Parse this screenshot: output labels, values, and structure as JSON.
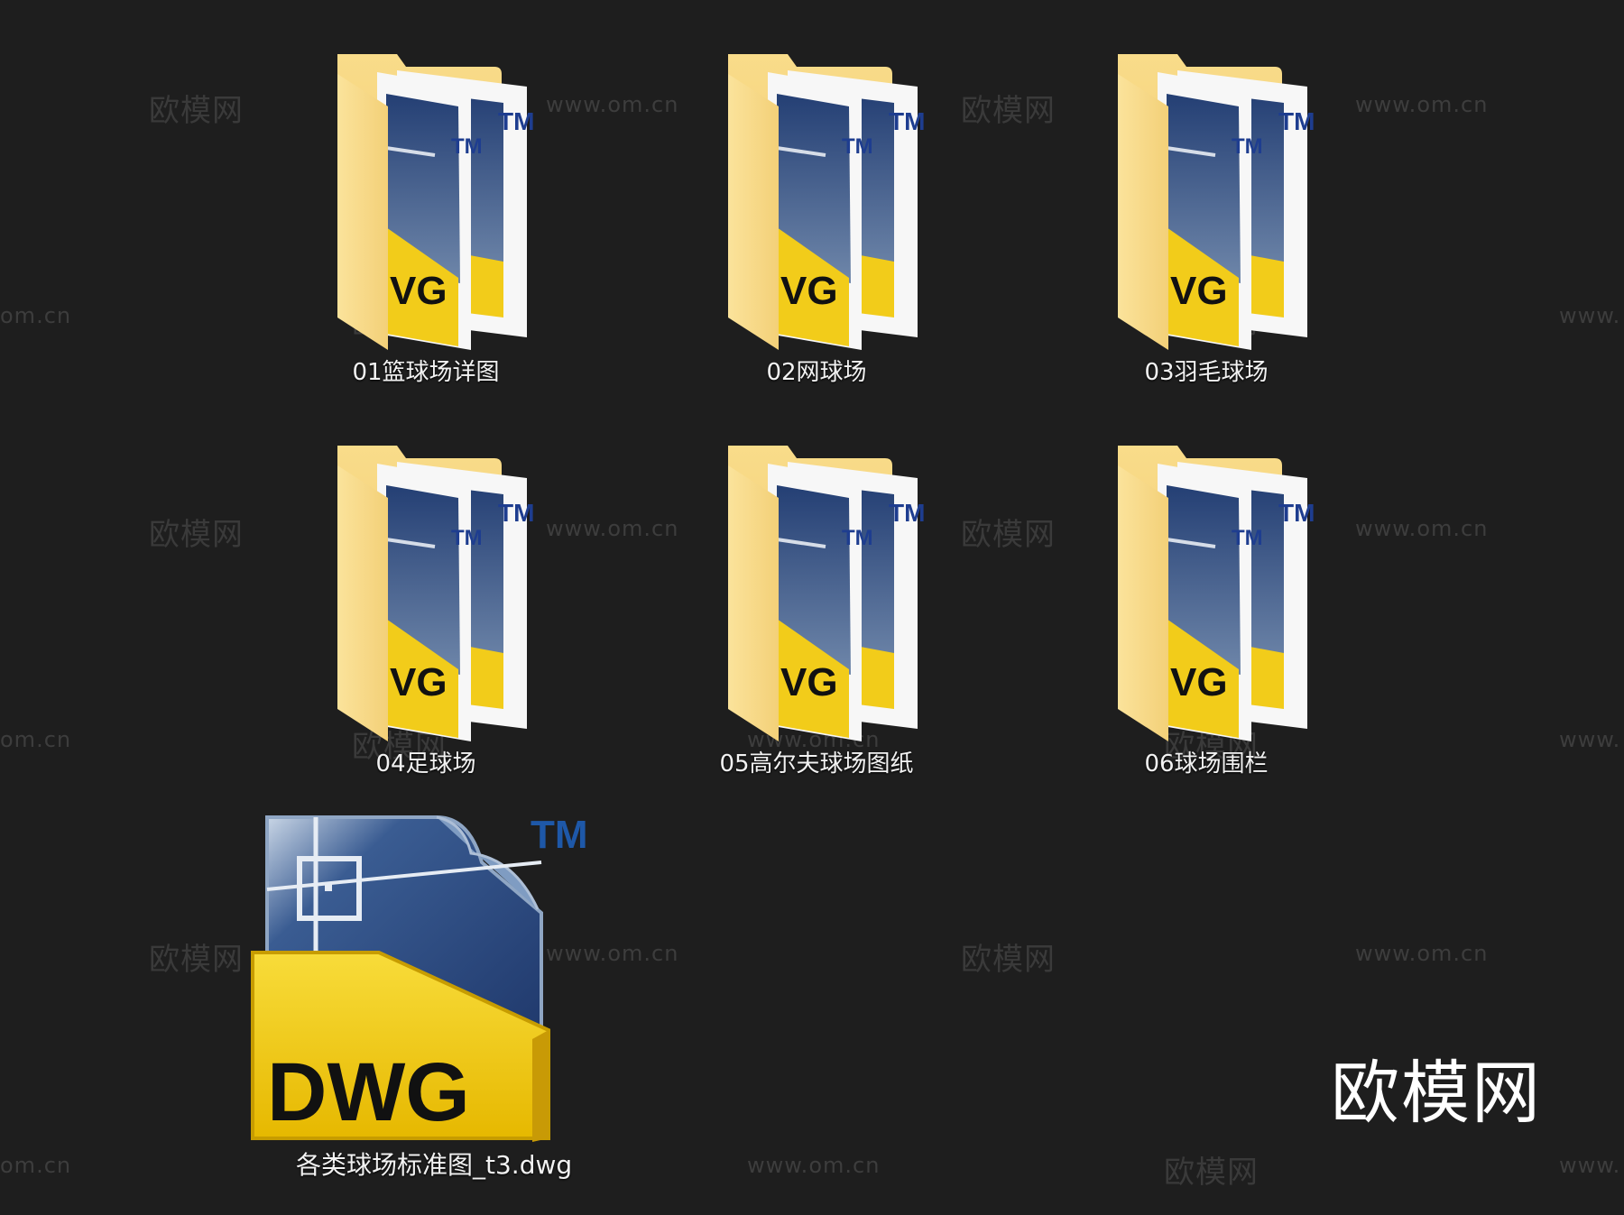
{
  "folders": [
    {
      "label": "01篮球场详图",
      "icon": "folder-dwg-icon"
    },
    {
      "label": "02网球场",
      "icon": "folder-dwg-icon"
    },
    {
      "label": "03羽毛球场",
      "icon": "folder-dwg-icon"
    },
    {
      "label": "04足球场",
      "icon": "folder-dwg-icon"
    },
    {
      "label": "05高尔夫球场图纸",
      "icon": "folder-dwg-icon"
    },
    {
      "label": "06球场围栏",
      "icon": "folder-dwg-icon"
    }
  ],
  "file": {
    "label": "各类球场标准图_t3.dwg",
    "icon": "dwg-file-icon",
    "badge": "DWG",
    "tm": "TM"
  },
  "watermark": {
    "brand": "欧模网",
    "url": "www.om.cn",
    "url_partial_left": "om.cn",
    "url_partial_right": "www."
  },
  "colors": {
    "background": "#1e1e1e",
    "folder": "#f7d57e",
    "dwg_yellow": "#f2cc1a",
    "dwg_blue": "#2b4a7e",
    "label": "#f2f2f2"
  }
}
